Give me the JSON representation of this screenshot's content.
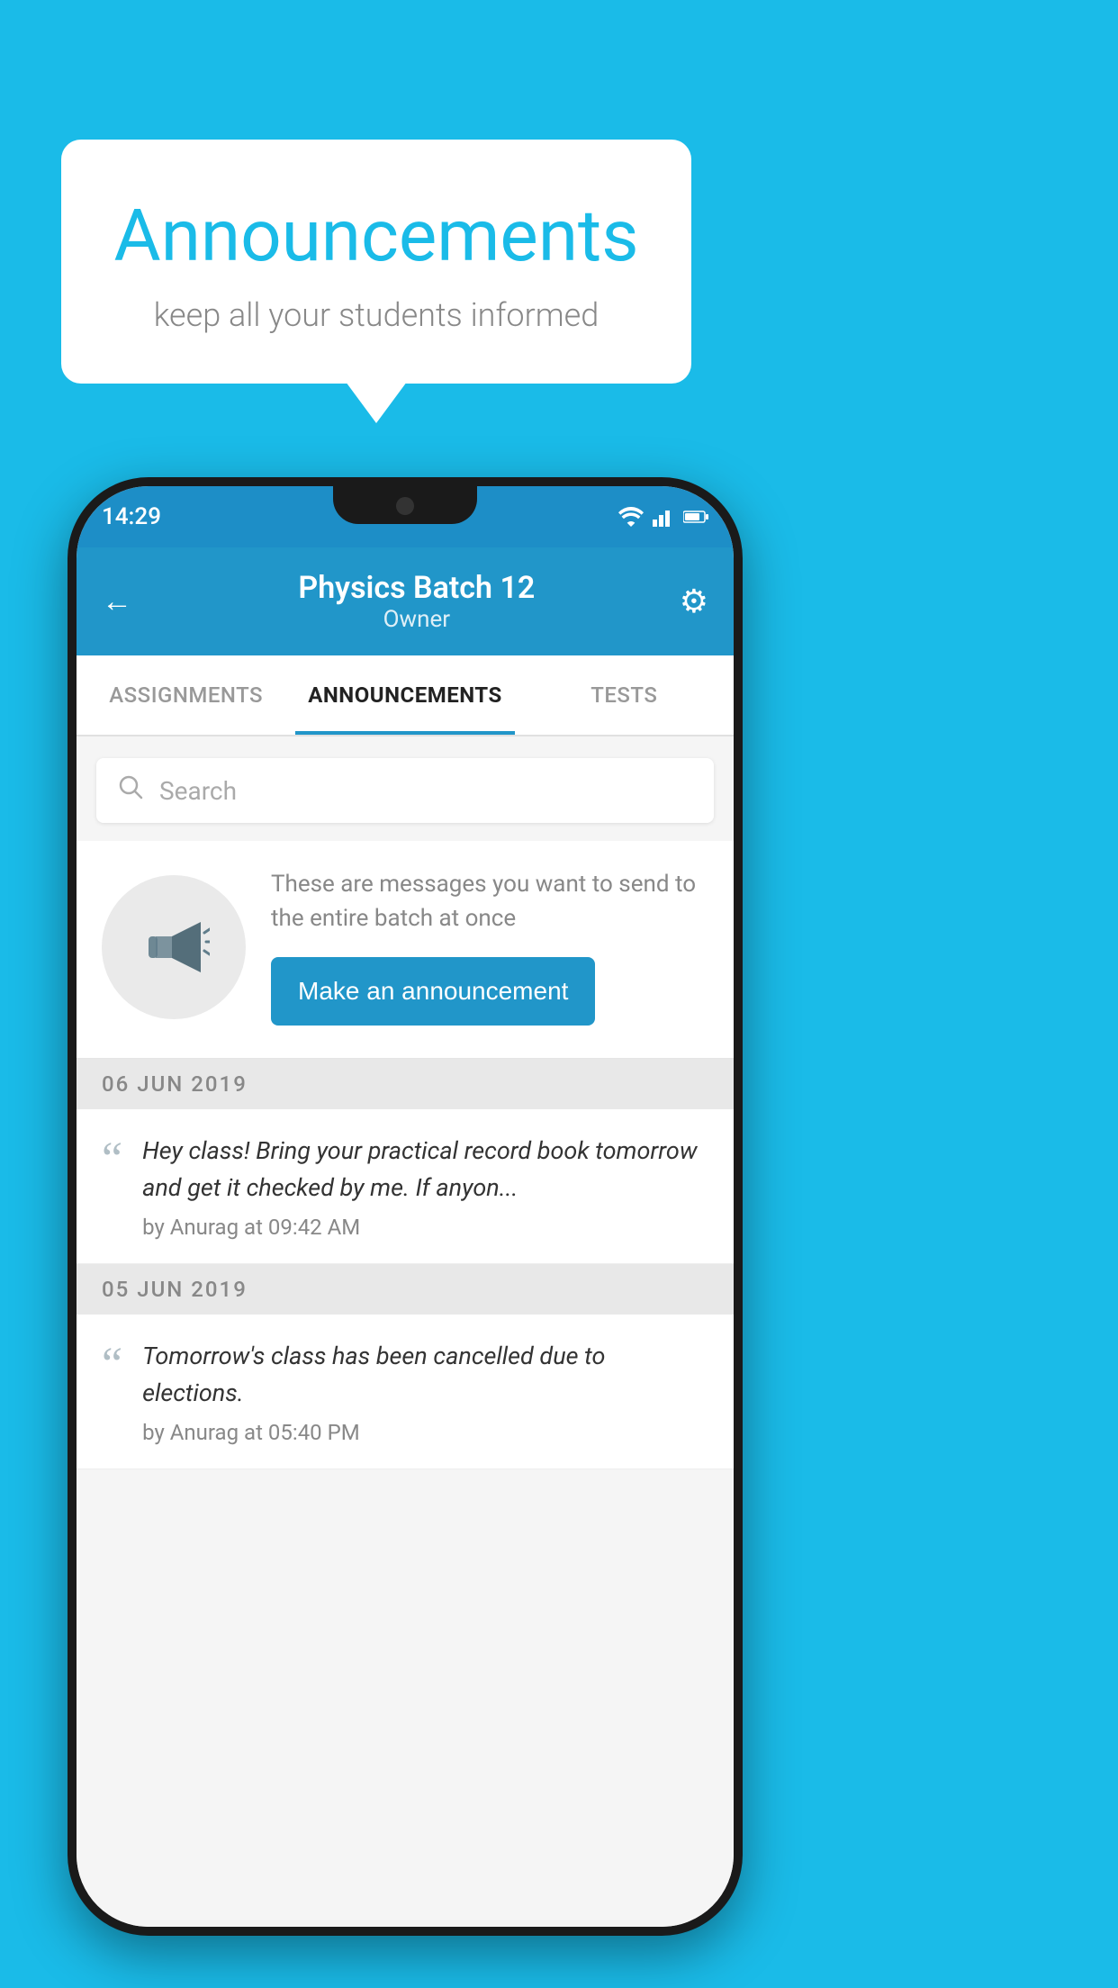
{
  "background_color": "#1ABBE8",
  "speech_bubble": {
    "title": "Announcements",
    "subtitle": "keep all your students informed"
  },
  "phone": {
    "status_bar": {
      "time": "14:29"
    },
    "app_bar": {
      "title": "Physics Batch 12",
      "subtitle": "Owner",
      "back_label": "←"
    },
    "tabs": [
      {
        "label": "ASSIGNMENTS",
        "active": false
      },
      {
        "label": "ANNOUNCEMENTS",
        "active": true
      },
      {
        "label": "TESTS",
        "active": false
      }
    ],
    "search": {
      "placeholder": "Search"
    },
    "promo": {
      "description": "These are messages you want to send to the entire batch at once",
      "button_label": "Make an announcement"
    },
    "announcements": [
      {
        "date": "06  JUN  2019",
        "message": "Hey class! Bring your practical record book tomorrow and get it checked by me. If anyon...",
        "meta": "by Anurag at 09:42 AM"
      },
      {
        "date": "05  JUN  2019",
        "message": "Tomorrow's class has been cancelled due to elections.",
        "meta": "by Anurag at 05:40 PM"
      }
    ]
  }
}
